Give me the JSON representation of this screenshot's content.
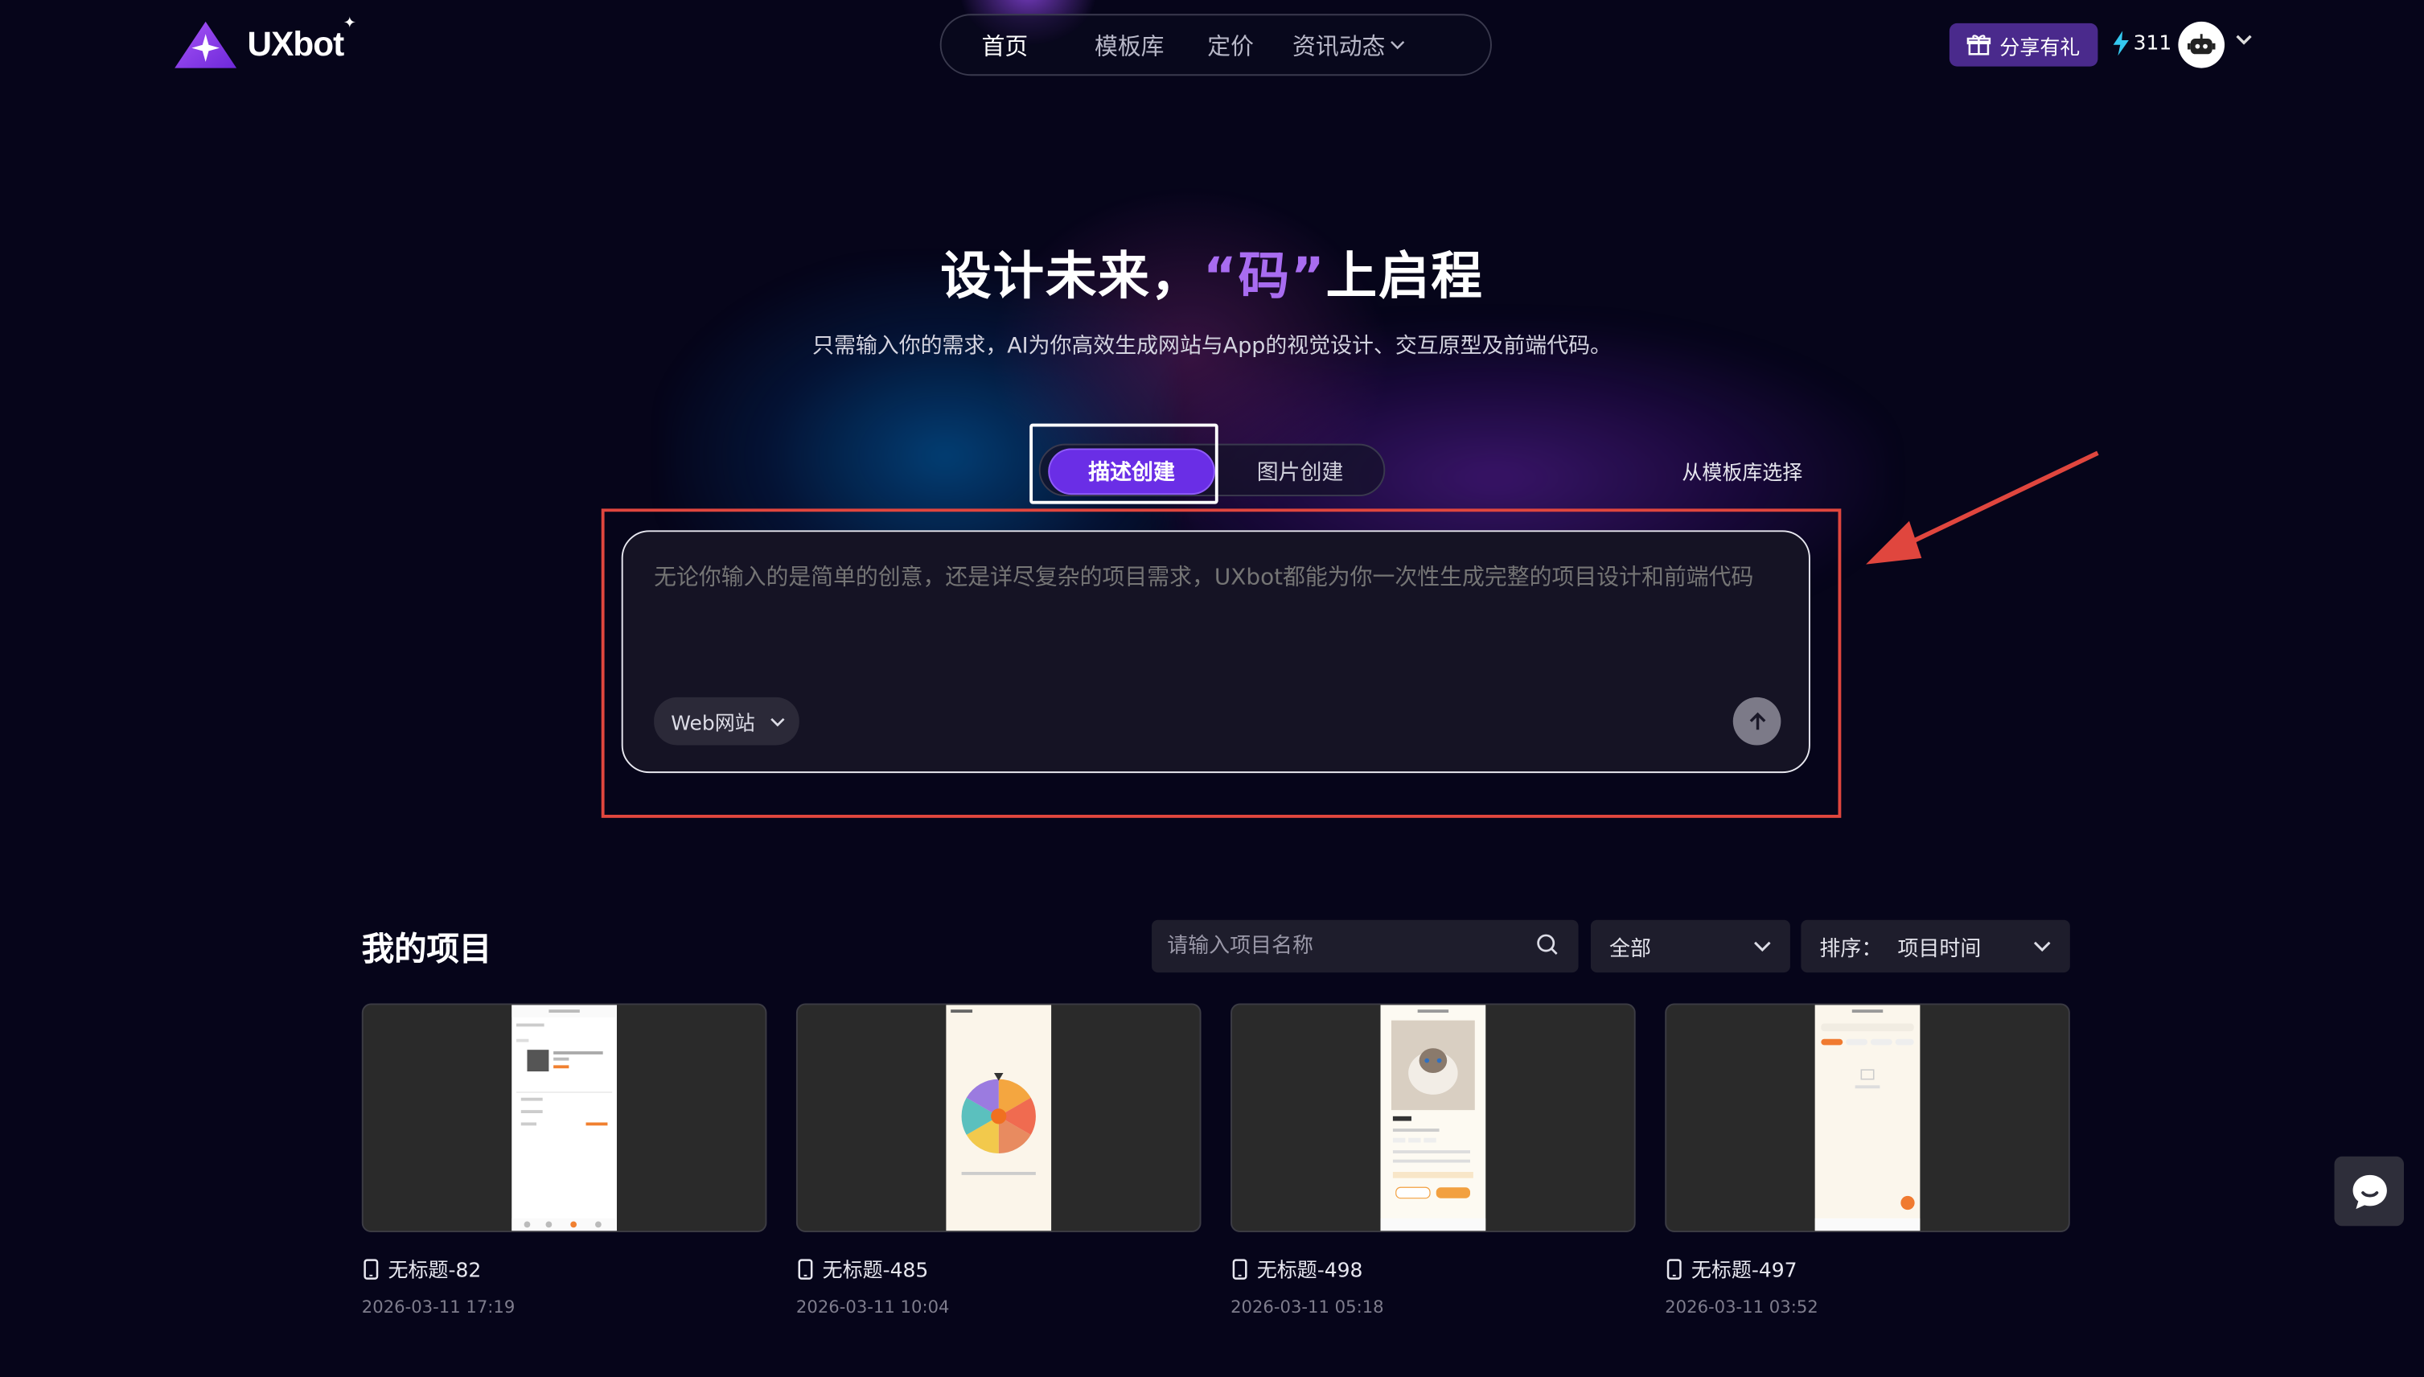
{
  "brand": {
    "name": "UXbot",
    "star": "✦"
  },
  "nav": {
    "items": [
      {
        "label": "首页",
        "active": true
      },
      {
        "label": "模板库",
        "active": false
      },
      {
        "label": "定价",
        "active": false
      },
      {
        "label": "资讯动态",
        "active": false,
        "has_dropdown": true
      }
    ]
  },
  "header": {
    "share_label": "分享有礼",
    "credits": "311",
    "icons": [
      "gift-icon",
      "bolt-icon",
      "robot-avatar-icon",
      "chevron-down-icon"
    ]
  },
  "hero": {
    "title_before": "设计未来，",
    "title_accent": "“码”",
    "title_after": "上启程",
    "subtitle": "只需输入你的需求，AI为你高效生成网站与App的视觉设计、交互原型及前端代码。"
  },
  "mode_tabs": {
    "describe": "描述创建",
    "image": "图片创建",
    "active": "describe",
    "template_link": "从模板库选择"
  },
  "prompt": {
    "placeholder": "无论你输入的是简单的创意，还是详尽复杂的项目需求，UXbot都能为你一次性生成完整的项目设计和前端代码",
    "value": "",
    "platform_select": "Web网站"
  },
  "projects": {
    "title": "我的项目",
    "search_placeholder": "请输入项目名称",
    "filter_value": "全部",
    "sort_label": "排序：",
    "sort_value": "项目时间",
    "items": [
      {
        "name": "无标题-82",
        "date": "2026-03-11 17:19",
        "device": "mobile"
      },
      {
        "name": "无标题-485",
        "date": "2026-03-11 10:04",
        "device": "mobile"
      },
      {
        "name": "无标题-498",
        "date": "2026-03-11 05:18",
        "device": "mobile"
      },
      {
        "name": "无标题-497",
        "date": "2026-03-11 03:52",
        "device": "mobile"
      }
    ]
  },
  "colors": {
    "background": "#06051a",
    "accent_purple": "#6a2ee6",
    "title_accent": "#a86cf0",
    "annotation_red": "#e0463e"
  }
}
